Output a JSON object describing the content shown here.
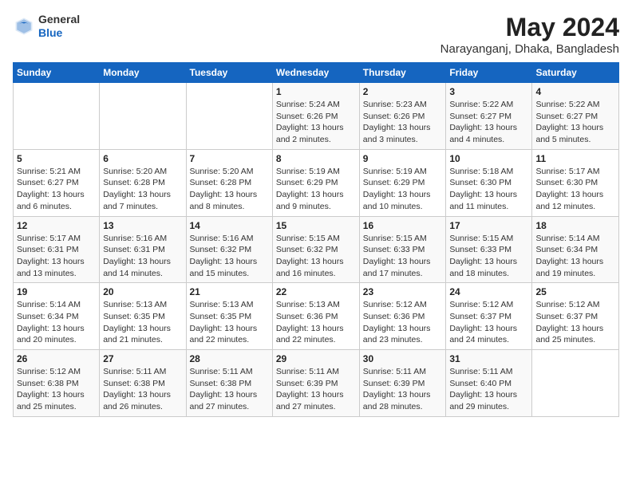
{
  "logo": {
    "general": "General",
    "blue": "Blue"
  },
  "title": "May 2024",
  "subtitle": "Narayanganj, Dhaka, Bangladesh",
  "weekdays": [
    "Sunday",
    "Monday",
    "Tuesday",
    "Wednesday",
    "Thursday",
    "Friday",
    "Saturday"
  ],
  "weeks": [
    [
      {
        "day": "",
        "info": ""
      },
      {
        "day": "",
        "info": ""
      },
      {
        "day": "",
        "info": ""
      },
      {
        "day": "1",
        "info": "Sunrise: 5:24 AM\nSunset: 6:26 PM\nDaylight: 13 hours\nand 2 minutes."
      },
      {
        "day": "2",
        "info": "Sunrise: 5:23 AM\nSunset: 6:26 PM\nDaylight: 13 hours\nand 3 minutes."
      },
      {
        "day": "3",
        "info": "Sunrise: 5:22 AM\nSunset: 6:27 PM\nDaylight: 13 hours\nand 4 minutes."
      },
      {
        "day": "4",
        "info": "Sunrise: 5:22 AM\nSunset: 6:27 PM\nDaylight: 13 hours\nand 5 minutes."
      }
    ],
    [
      {
        "day": "5",
        "info": "Sunrise: 5:21 AM\nSunset: 6:27 PM\nDaylight: 13 hours\nand 6 minutes."
      },
      {
        "day": "6",
        "info": "Sunrise: 5:20 AM\nSunset: 6:28 PM\nDaylight: 13 hours\nand 7 minutes."
      },
      {
        "day": "7",
        "info": "Sunrise: 5:20 AM\nSunset: 6:28 PM\nDaylight: 13 hours\nand 8 minutes."
      },
      {
        "day": "8",
        "info": "Sunrise: 5:19 AM\nSunset: 6:29 PM\nDaylight: 13 hours\nand 9 minutes."
      },
      {
        "day": "9",
        "info": "Sunrise: 5:19 AM\nSunset: 6:29 PM\nDaylight: 13 hours\nand 10 minutes."
      },
      {
        "day": "10",
        "info": "Sunrise: 5:18 AM\nSunset: 6:30 PM\nDaylight: 13 hours\nand 11 minutes."
      },
      {
        "day": "11",
        "info": "Sunrise: 5:17 AM\nSunset: 6:30 PM\nDaylight: 13 hours\nand 12 minutes."
      }
    ],
    [
      {
        "day": "12",
        "info": "Sunrise: 5:17 AM\nSunset: 6:31 PM\nDaylight: 13 hours\nand 13 minutes."
      },
      {
        "day": "13",
        "info": "Sunrise: 5:16 AM\nSunset: 6:31 PM\nDaylight: 13 hours\nand 14 minutes."
      },
      {
        "day": "14",
        "info": "Sunrise: 5:16 AM\nSunset: 6:32 PM\nDaylight: 13 hours\nand 15 minutes."
      },
      {
        "day": "15",
        "info": "Sunrise: 5:15 AM\nSunset: 6:32 PM\nDaylight: 13 hours\nand 16 minutes."
      },
      {
        "day": "16",
        "info": "Sunrise: 5:15 AM\nSunset: 6:33 PM\nDaylight: 13 hours\nand 17 minutes."
      },
      {
        "day": "17",
        "info": "Sunrise: 5:15 AM\nSunset: 6:33 PM\nDaylight: 13 hours\nand 18 minutes."
      },
      {
        "day": "18",
        "info": "Sunrise: 5:14 AM\nSunset: 6:34 PM\nDaylight: 13 hours\nand 19 minutes."
      }
    ],
    [
      {
        "day": "19",
        "info": "Sunrise: 5:14 AM\nSunset: 6:34 PM\nDaylight: 13 hours\nand 20 minutes."
      },
      {
        "day": "20",
        "info": "Sunrise: 5:13 AM\nSunset: 6:35 PM\nDaylight: 13 hours\nand 21 minutes."
      },
      {
        "day": "21",
        "info": "Sunrise: 5:13 AM\nSunset: 6:35 PM\nDaylight: 13 hours\nand 22 minutes."
      },
      {
        "day": "22",
        "info": "Sunrise: 5:13 AM\nSunset: 6:36 PM\nDaylight: 13 hours\nand 22 minutes."
      },
      {
        "day": "23",
        "info": "Sunrise: 5:12 AM\nSunset: 6:36 PM\nDaylight: 13 hours\nand 23 minutes."
      },
      {
        "day": "24",
        "info": "Sunrise: 5:12 AM\nSunset: 6:37 PM\nDaylight: 13 hours\nand 24 minutes."
      },
      {
        "day": "25",
        "info": "Sunrise: 5:12 AM\nSunset: 6:37 PM\nDaylight: 13 hours\nand 25 minutes."
      }
    ],
    [
      {
        "day": "26",
        "info": "Sunrise: 5:12 AM\nSunset: 6:38 PM\nDaylight: 13 hours\nand 25 minutes."
      },
      {
        "day": "27",
        "info": "Sunrise: 5:11 AM\nSunset: 6:38 PM\nDaylight: 13 hours\nand 26 minutes."
      },
      {
        "day": "28",
        "info": "Sunrise: 5:11 AM\nSunset: 6:38 PM\nDaylight: 13 hours\nand 27 minutes."
      },
      {
        "day": "29",
        "info": "Sunrise: 5:11 AM\nSunset: 6:39 PM\nDaylight: 13 hours\nand 27 minutes."
      },
      {
        "day": "30",
        "info": "Sunrise: 5:11 AM\nSunset: 6:39 PM\nDaylight: 13 hours\nand 28 minutes."
      },
      {
        "day": "31",
        "info": "Sunrise: 5:11 AM\nSunset: 6:40 PM\nDaylight: 13 hours\nand 29 minutes."
      },
      {
        "day": "",
        "info": ""
      }
    ]
  ]
}
